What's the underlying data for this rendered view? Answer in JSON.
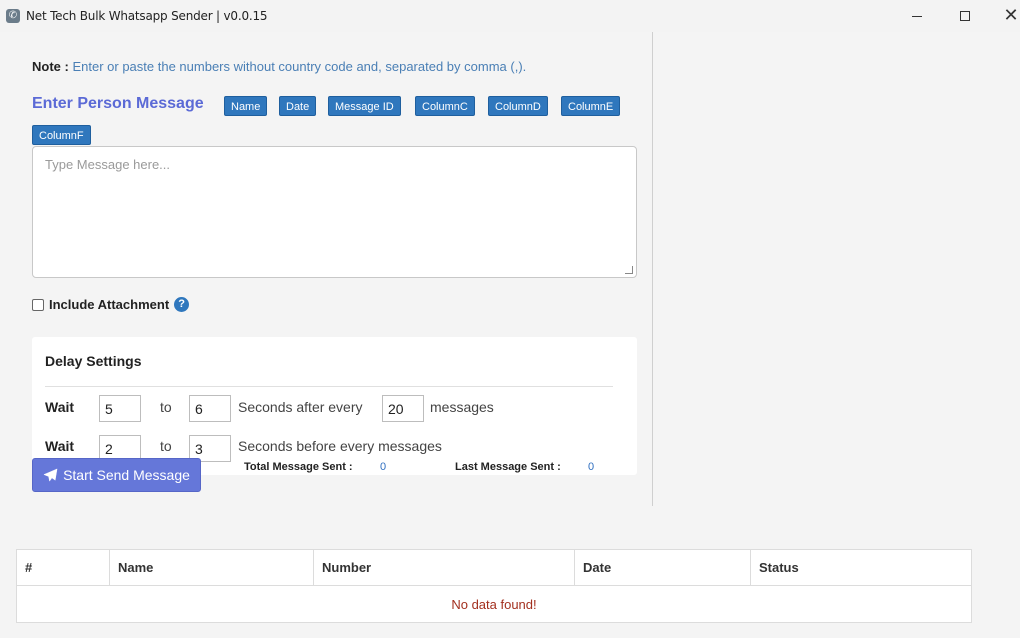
{
  "window": {
    "title": "Net Tech Bulk Whatsapp Sender | v0.0.15",
    "minimize_symbol": "—",
    "maximize_symbol": "☐",
    "close_symbol": "✕"
  },
  "note": {
    "label": "Note :",
    "text": "Enter or paste the numbers without country code and, separated by comma (,)."
  },
  "message": {
    "heading": "Enter Person Message",
    "placeholders": [
      "Name",
      "Date",
      "Message ID",
      "ColumnC",
      "ColumnD",
      "ColumnE",
      "ColumnF"
    ],
    "textarea_placeholder": "Type Message here..."
  },
  "attachment": {
    "label": "Include Attachment",
    "checked": false,
    "help_icon": "question-circle-icon"
  },
  "delay": {
    "title": "Delay Settings",
    "row1": {
      "wait_label": "Wait",
      "from": "5",
      "to_label": "to",
      "to": "6",
      "middle_label": "Seconds after every",
      "count": "20",
      "suffix_label": "messages"
    },
    "row2": {
      "wait_label": "Wait",
      "from": "2",
      "to_label": "to",
      "to": "3",
      "suffix_label": "Seconds before every messages"
    }
  },
  "actions": {
    "send_label": "Start Send Message",
    "send_icon": "paper-plane-icon"
  },
  "stats": {
    "total_label": "Total Message Sent :",
    "total_value": "0",
    "last_label": "Last Message Sent :",
    "last_value": "0"
  },
  "table": {
    "columns": [
      "#",
      "Name",
      "Number",
      "Date",
      "Status"
    ],
    "empty_text": "No data found!"
  },
  "colors": {
    "accent": "#5b6ad6",
    "chip": "#2f77bd",
    "button": "#6577d9",
    "empty_text": "#a3301f"
  }
}
